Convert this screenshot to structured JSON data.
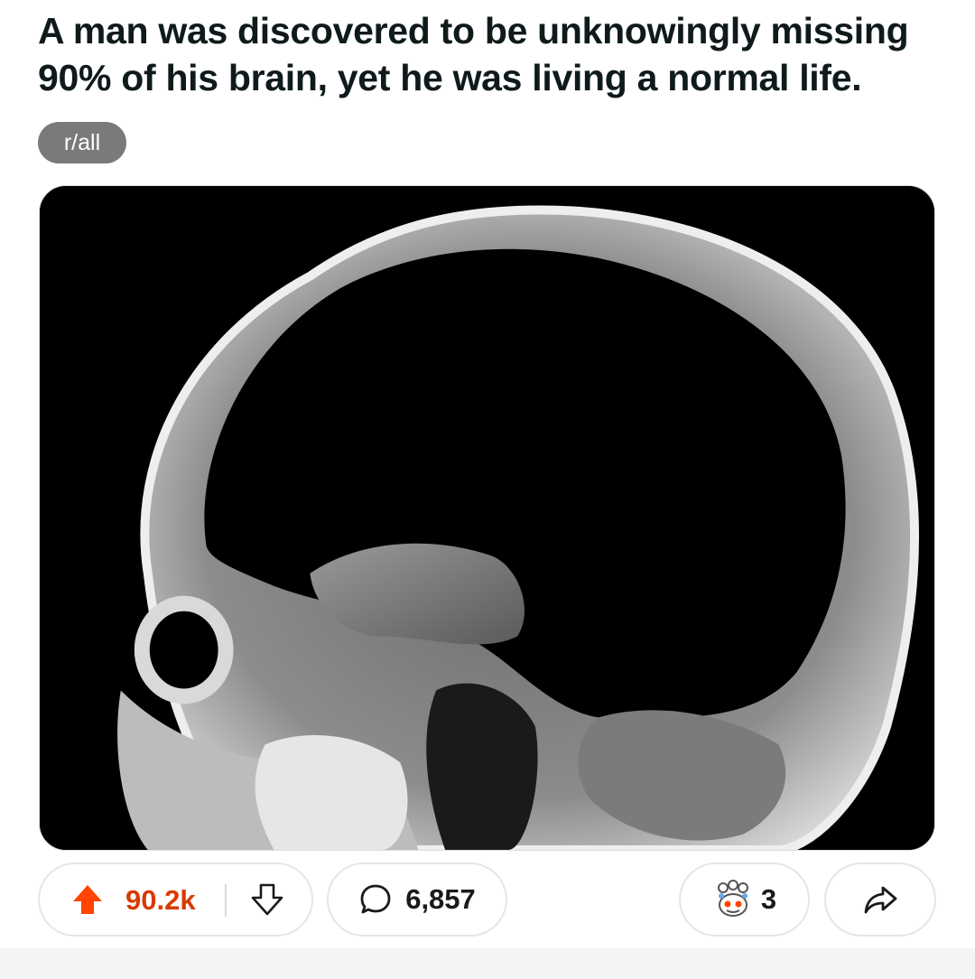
{
  "post": {
    "title": "A man was discovered to be unknowingly missing 90% of his brain, yet he was living a normal life.",
    "subreddit": "r/all",
    "image_description_icon": "brain-mri-scan-image"
  },
  "actions": {
    "vote_count": "90.2k",
    "comment_count": "6,857",
    "award_count": "3",
    "upvote_icon": "upvote-arrow-icon",
    "downvote_icon": "downvote-arrow-icon",
    "comment_icon": "speech-bubble-icon",
    "award_icon": "award-icon",
    "share_icon": "share-arrow-icon"
  },
  "colors": {
    "upvote_active": "#ff4500",
    "vote_count": "#d93a00",
    "chip_bg": "#7a7a7a"
  }
}
